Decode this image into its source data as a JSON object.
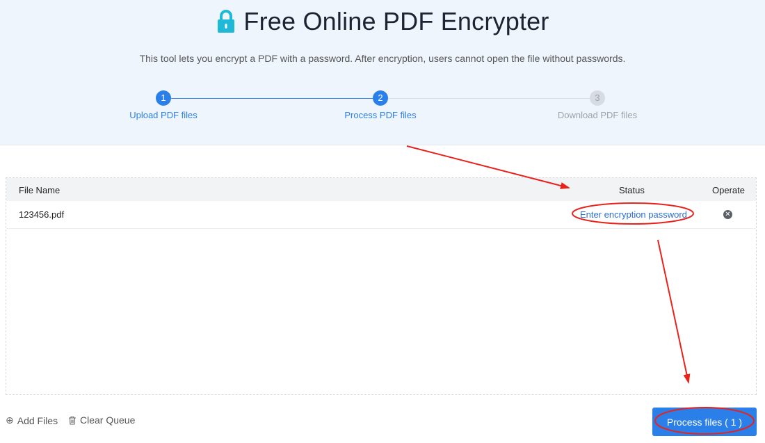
{
  "header": {
    "title": "Free Online PDF Encrypter",
    "subtitle": "This tool lets you encrypt a PDF with a password. After encryption, users cannot open the file without passwords.",
    "icon": "lock-icon",
    "icon_color": "#1fb8d6"
  },
  "steps": [
    {
      "number": "1",
      "label": "Upload PDF files",
      "state": "active"
    },
    {
      "number": "2",
      "label": "Process PDF files",
      "state": "active"
    },
    {
      "number": "3",
      "label": "Download PDF files",
      "state": "inactive"
    }
  ],
  "table": {
    "columns": {
      "file_name": "File Name",
      "status": "Status",
      "operate": "Operate"
    },
    "rows": [
      {
        "file_name": "123456.pdf",
        "status": "Enter encryption password",
        "operate_icon": "remove-icon"
      }
    ]
  },
  "footer": {
    "add_files": "Add Files",
    "clear_queue": "Clear Queue",
    "process_button": "Process files ( 1 )"
  },
  "colors": {
    "accent": "#2b7fe8",
    "hero_bg": "#eef5fd",
    "annotation": "#e8231b"
  }
}
